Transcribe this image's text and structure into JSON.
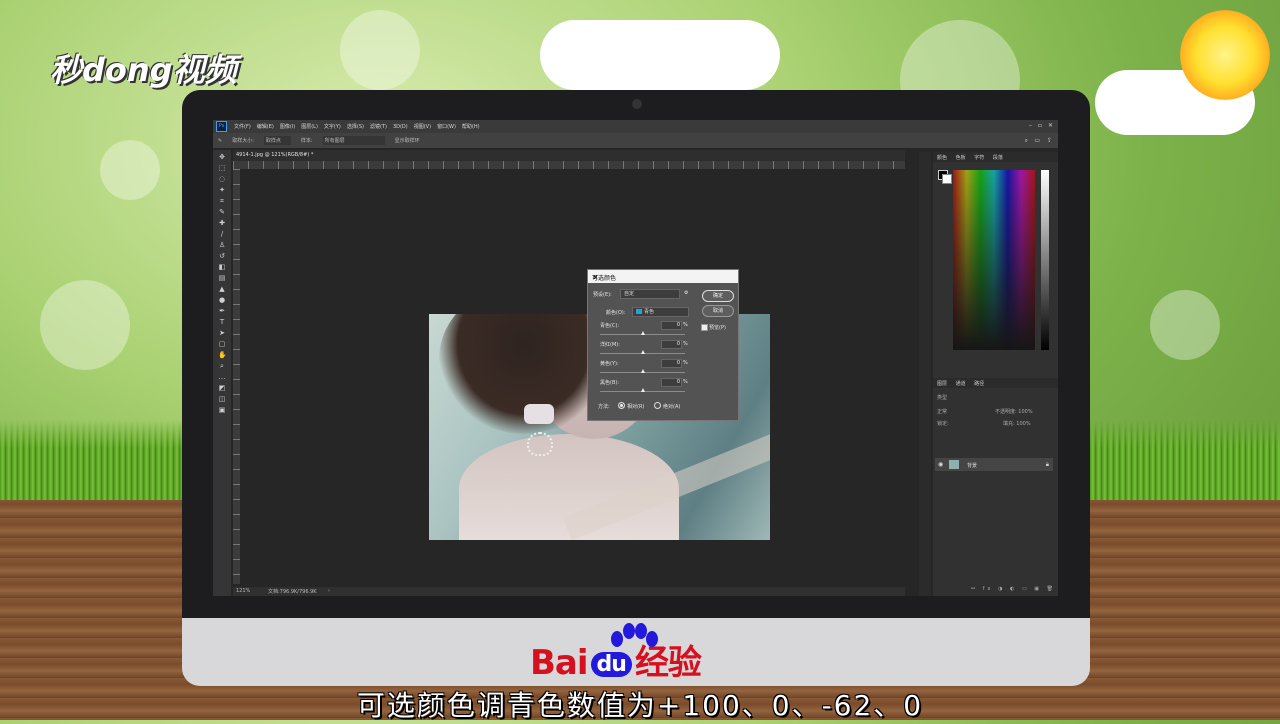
{
  "brand": {
    "logo_text": "秒dong视频"
  },
  "photoshop": {
    "app_icon": "Ps",
    "menu": [
      "文件(F)",
      "编辑(E)",
      "图像(I)",
      "图层(L)",
      "文字(Y)",
      "选择(S)",
      "滤镜(T)",
      "3D(D)",
      "视图(V)",
      "窗口(W)",
      "帮助(H)"
    ],
    "options_bar": [
      "取样大小:",
      "取样点",
      "样本:",
      "所有图层",
      "显示取样环"
    ],
    "document_tab": "4914-1.jpg @ 121%(RGB/8#) *",
    "status": {
      "zoom": "121%",
      "doc": "文档:796.9K/796.9K"
    },
    "right_panel": {
      "color_tabs": [
        "颜色",
        "色板",
        "字符",
        "段落"
      ],
      "layers_tabs": [
        "图层",
        "通道",
        "路径"
      ],
      "layer_kind_label": "类型",
      "blend_mode": "正常",
      "opacity_label": "不透明度: 100%",
      "lock_label": "锁定:",
      "fill_label": "填充: 100%",
      "layer_name": "背景"
    }
  },
  "dialog": {
    "title": "可选颜色",
    "preset_label": "预设(E):",
    "preset_value": "自定",
    "colors_label": "颜色(O):",
    "colors_value": "青色",
    "sliders": [
      {
        "label": "青色(C):",
        "value": "0",
        "unit": "%"
      },
      {
        "label": "洋红(M):",
        "value": "0",
        "unit": "%"
      },
      {
        "label": "黄色(Y):",
        "value": "0",
        "unit": "%"
      },
      {
        "label": "黑色(B):",
        "value": "0",
        "unit": "%"
      }
    ],
    "ok_label": "确定",
    "cancel_label": "取消",
    "preview_label": "预览(P)",
    "method_label": "方法:",
    "relative_label": "相对(R)",
    "absolute_label": "绝对(A)"
  },
  "footer": {
    "baidu_prefix": "Bai",
    "baidu_du": "du",
    "baidu_suffix": "经验",
    "caption": "可选颜色调青色数值为+100、0、-62、0"
  }
}
